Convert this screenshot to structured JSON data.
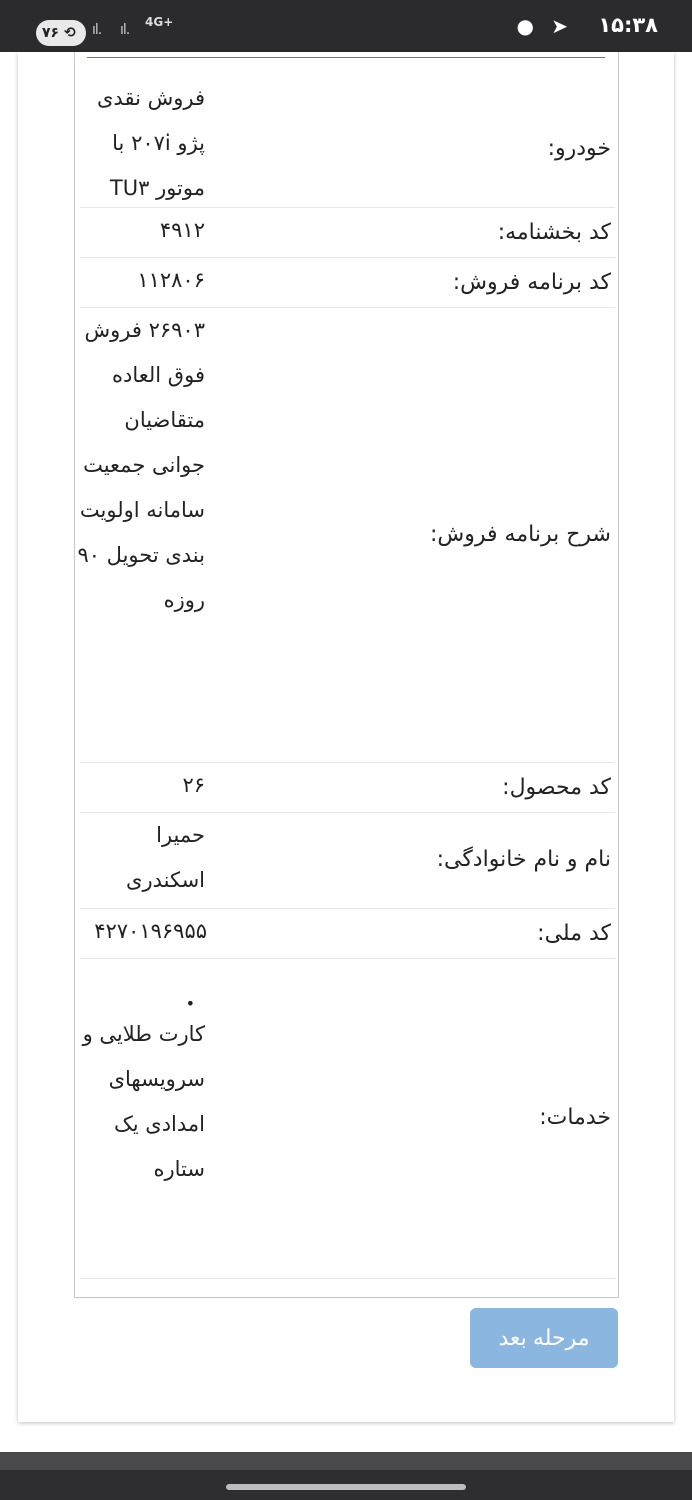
{
  "status_bar": {
    "time": "۱۵:۳۸",
    "network": "4G+",
    "battery": "۷۶",
    "icons": [
      "telegram-icon",
      "message-icon",
      "signal-icon",
      "battery-icon"
    ]
  },
  "details": [
    {
      "label": "خودرو:",
      "value": "فروش نقدی پژو ۲۰۷i با موتور TU۳"
    },
    {
      "label": "کد بخشنامه:",
      "value": "۴۹۱۲"
    },
    {
      "label": "کد برنامه فروش:",
      "value": "۱۱۲۸۰۶"
    },
    {
      "label": "شرح برنامه فروش:",
      "value": "۲۶۹۰۳ فروش فوق العاده متقاضیان جوانی جمعیت سامانه اولویت بندی تحویل ۹۰ روزه"
    },
    {
      "label": "کد محصول:",
      "value": "۲۶"
    },
    {
      "label": "نام و نام خانوادگی:",
      "value": "حمیرا اسکندری"
    },
    {
      "label": "کد ملی:",
      "value": "۴۲۷۰۱۹۶۹۵۵"
    },
    {
      "label": "خدمات:",
      "value": "کارت طلایی و سرویسهای امدادی یک ستاره"
    }
  ],
  "services_bullet": "•",
  "next_button": "مرحله بعد"
}
